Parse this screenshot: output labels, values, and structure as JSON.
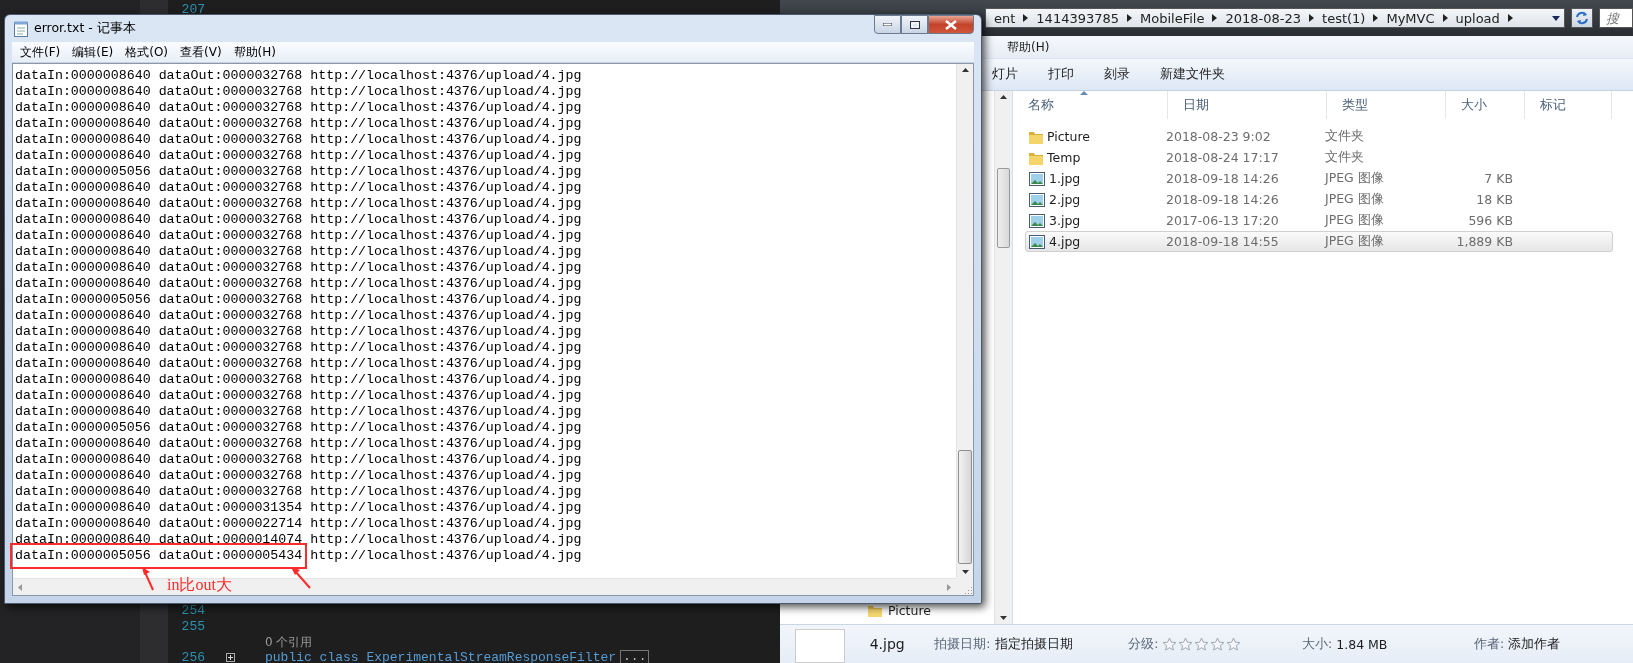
{
  "editor": {
    "lines": [
      {
        "kind": "code",
        "number": "207"
      },
      {
        "kind": "code",
        "number": "254"
      },
      {
        "kind": "code",
        "number": "255"
      },
      {
        "kind": "codelens",
        "text": "0 个引用"
      },
      {
        "kind": "code",
        "number": "256",
        "text": "public class ExperimentalStreamResponseFilter",
        "fold": "..."
      }
    ]
  },
  "explorer": {
    "address_bar": {
      "segments": [
        "ent",
        "1414393785",
        "MobileFile",
        "2018-08-23",
        "test(1)",
        "MyMVC",
        "upload"
      ]
    },
    "search": {
      "placeholder": "搜"
    },
    "menu": [
      "帮助(H)"
    ],
    "toolbar": [
      "灯片",
      "打印",
      "刻录",
      "新建文件夹"
    ],
    "nav_items": [
      "Picture"
    ],
    "columns": [
      "名称",
      "日期",
      "类型",
      "大小",
      "标记"
    ],
    "files": [
      {
        "kind": "folder",
        "name": "Picture",
        "date": "2018-08-23 9:02",
        "type": "文件夹",
        "selected": false
      },
      {
        "kind": "folder",
        "name": "Temp",
        "date": "2018-08-24 17:17",
        "type": "文件夹",
        "selected": false
      },
      {
        "kind": "image",
        "name": "1.jpg",
        "date": "2018-09-18 14:26",
        "type": "JPEG 图像",
        "size": "7 KB",
        "selected": false
      },
      {
        "kind": "image",
        "name": "2.jpg",
        "date": "2018-09-18 14:26",
        "type": "JPEG 图像",
        "size": "18 KB",
        "selected": false
      },
      {
        "kind": "image",
        "name": "3.jpg",
        "date": "2017-06-13 17:20",
        "type": "JPEG 图像",
        "size": "596 KB",
        "selected": false
      },
      {
        "kind": "image",
        "name": "4.jpg",
        "date": "2018-09-18 14:55",
        "type": "JPEG 图像",
        "size": "1,889 KB",
        "selected": true
      }
    ],
    "details": {
      "file_name": "4.jpg",
      "date_taken": {
        "label": "拍摄日期:",
        "value": "指定拍摄日期"
      },
      "rating": {
        "label": "分级:",
        "stars": 0
      },
      "size": {
        "label": "大小:",
        "value": "1.84 MB"
      },
      "author": {
        "label": "作者:",
        "value": "添加作者"
      }
    }
  },
  "notepad": {
    "title": "error.txt - 记事本",
    "menu": [
      "文件(F)",
      "编辑(E)",
      "格式(O)",
      "查看(V)",
      "帮助(H)"
    ],
    "lines": [
      "dataIn:0000008640 dataOut:0000032768 http://localhost:4376/upload/4.jpg",
      "dataIn:0000008640 dataOut:0000032768 http://localhost:4376/upload/4.jpg",
      "dataIn:0000008640 dataOut:0000032768 http://localhost:4376/upload/4.jpg",
      "dataIn:0000008640 dataOut:0000032768 http://localhost:4376/upload/4.jpg",
      "dataIn:0000008640 dataOut:0000032768 http://localhost:4376/upload/4.jpg",
      "dataIn:0000008640 dataOut:0000032768 http://localhost:4376/upload/4.jpg",
      "dataIn:0000005056 dataOut:0000032768 http://localhost:4376/upload/4.jpg",
      "dataIn:0000008640 dataOut:0000032768 http://localhost:4376/upload/4.jpg",
      "dataIn:0000008640 dataOut:0000032768 http://localhost:4376/upload/4.jpg",
      "dataIn:0000008640 dataOut:0000032768 http://localhost:4376/upload/4.jpg",
      "dataIn:0000008640 dataOut:0000032768 http://localhost:4376/upload/4.jpg",
      "dataIn:0000008640 dataOut:0000032768 http://localhost:4376/upload/4.jpg",
      "dataIn:0000008640 dataOut:0000032768 http://localhost:4376/upload/4.jpg",
      "dataIn:0000008640 dataOut:0000032768 http://localhost:4376/upload/4.jpg",
      "dataIn:0000005056 dataOut:0000032768 http://localhost:4376/upload/4.jpg",
      "dataIn:0000008640 dataOut:0000032768 http://localhost:4376/upload/4.jpg",
      "dataIn:0000008640 dataOut:0000032768 http://localhost:4376/upload/4.jpg",
      "dataIn:0000008640 dataOut:0000032768 http://localhost:4376/upload/4.jpg",
      "dataIn:0000008640 dataOut:0000032768 http://localhost:4376/upload/4.jpg",
      "dataIn:0000008640 dataOut:0000032768 http://localhost:4376/upload/4.jpg",
      "dataIn:0000008640 dataOut:0000032768 http://localhost:4376/upload/4.jpg",
      "dataIn:0000008640 dataOut:0000032768 http://localhost:4376/upload/4.jpg",
      "dataIn:0000005056 dataOut:0000032768 http://localhost:4376/upload/4.jpg",
      "dataIn:0000008640 dataOut:0000032768 http://localhost:4376/upload/4.jpg",
      "dataIn:0000008640 dataOut:0000032768 http://localhost:4376/upload/4.jpg",
      "dataIn:0000008640 dataOut:0000032768 http://localhost:4376/upload/4.jpg",
      "dataIn:0000008640 dataOut:0000032768 http://localhost:4376/upload/4.jpg",
      "dataIn:0000008640 dataOut:0000031354 http://localhost:4376/upload/4.jpg",
      "dataIn:0000008640 dataOut:0000022714 http://localhost:4376/upload/4.jpg",
      "dataIn:0000008640 dataOut:0000014074 http://localhost:4376/upload/4.jpg",
      "dataIn:0000005056 dataOut:0000005434 http://localhost:4376/upload/4.jpg"
    ],
    "annotation": {
      "label": "in比out大"
    }
  }
}
